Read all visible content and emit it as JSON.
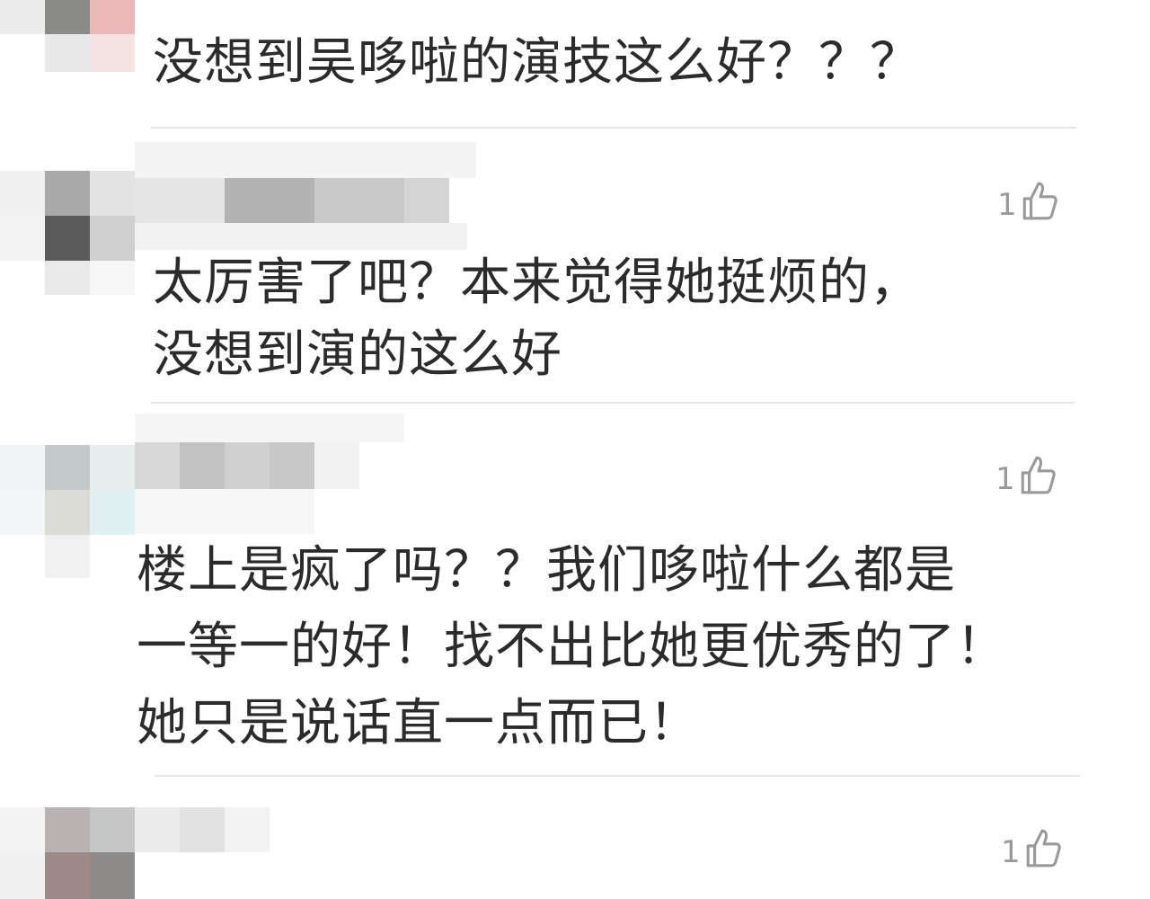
{
  "comments": [
    {
      "text": "没想到吴哆啦的演技这么好？？？",
      "likes": ""
    },
    {
      "text_lines": [
        "太厉害了吧？本来觉得她挺烦的，",
        "没想到演的这么好"
      ],
      "likes": "1"
    },
    {
      "text_lines": [
        "楼上是疯了吗？？我们哆啦什么都是",
        "一等一的好！找不出比她更优秀的了！",
        "她只是说话直一点而已！"
      ],
      "likes": "1"
    },
    {
      "text": "",
      "likes": "1"
    }
  ],
  "icons": {
    "like": "thumbs-up-icon"
  },
  "colors": {
    "text": "#2b2b2b",
    "like": "#9a9a9a",
    "divider": "#e6e6e6"
  }
}
